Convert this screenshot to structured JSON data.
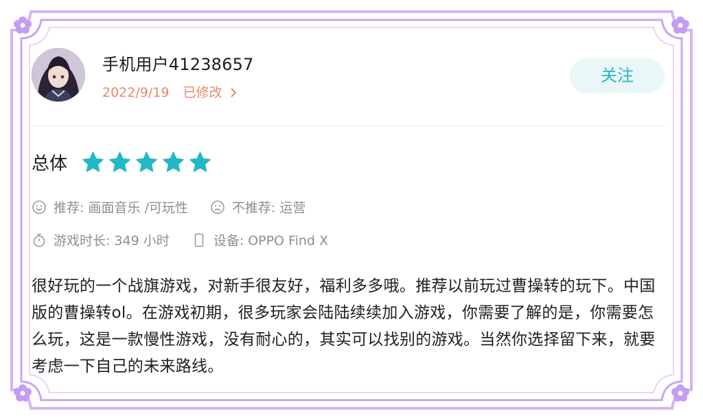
{
  "review": {
    "username": "手机用户41238657",
    "date": "2022/9/19",
    "edited_label": "已修改",
    "follow_label": "关注",
    "overall_label": "总体",
    "rating": 5,
    "recommend": "推荐: 画面音乐 /可玩性",
    "not_recommend": "不推荐: 运营",
    "playtime": "游戏时长:  349 小时",
    "device": "设备:  OPPO Find X",
    "text": "很好玩的一个战旗游戏，对新手很友好，福利多多哦。推荐以前玩过曹操转的玩下。中国版的曹操转ol。在游戏初期，很多玩家会陆陆续续加入游戏，你需要了解的是，你需要怎么玩，这是一款慢性游戏，没有耐心的，其实可以找别的游戏。当然你选择留下来，就要考虑一下自己的未来路线。"
  },
  "colors": {
    "frame": "#c9a6ee",
    "accent_teal": "#22b8c5",
    "date_orange": "#e8876a",
    "follow_bg": "#eaf7f8"
  },
  "icons": {
    "recommend": "smile-icon",
    "not_recommend": "frown-icon",
    "playtime": "stopwatch-icon",
    "device": "phone-icon",
    "edited": "chevron-right-icon",
    "star": "star-icon",
    "corner": "flower-icon"
  }
}
